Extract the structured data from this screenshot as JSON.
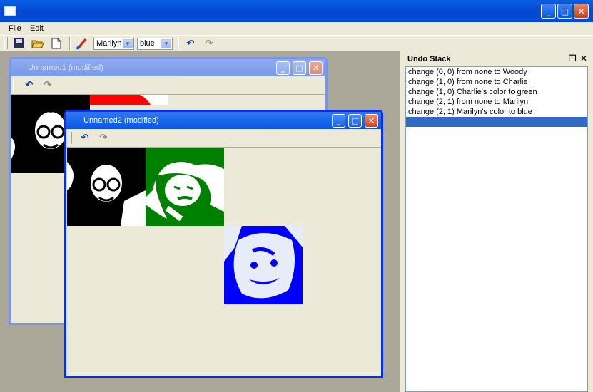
{
  "menu": [
    "File",
    "Edit"
  ],
  "toolbar": {
    "person_value": "Marilyn",
    "color_value": "blue"
  },
  "windows": {
    "w1": {
      "title": "Unnamed1 (modified)"
    },
    "w2": {
      "title": "Unnamed2 (modified)"
    }
  },
  "undo_stack": {
    "title": "Undo Stack",
    "items": [
      "change (0, 0) from none to Woody",
      "change (1, 0) from none to Charlie",
      "change (1, 0) Charlie's color to green",
      "change (2, 1) from none to Marilyn",
      "change (2, 1) Marilyn's color to blue",
      ""
    ]
  },
  "colors": {
    "green": "#008000",
    "blue": "#0000ff",
    "red": "#ff0000"
  }
}
